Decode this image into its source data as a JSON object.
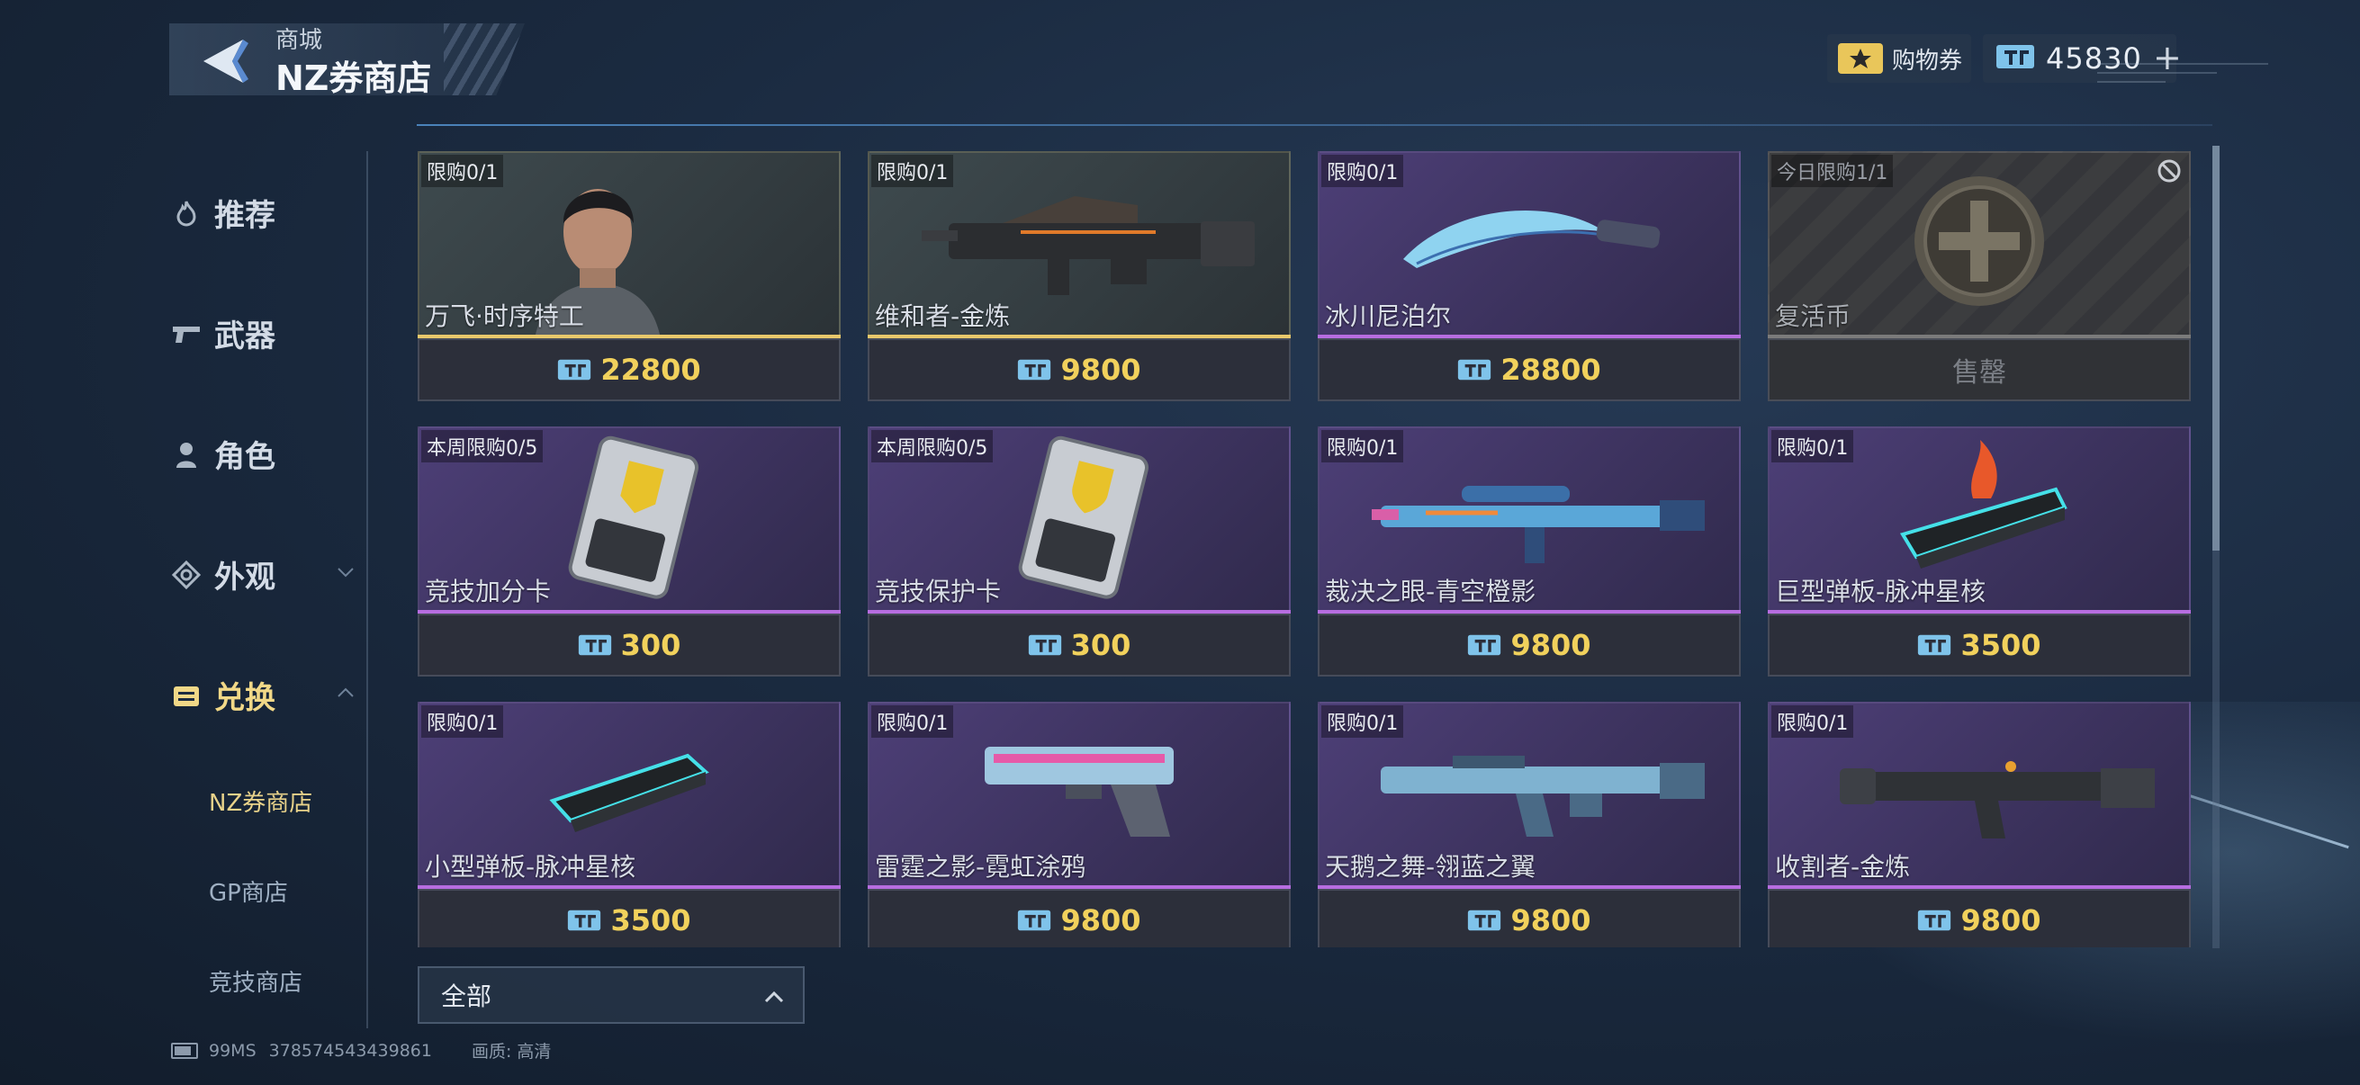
{
  "header": {
    "breadcrumb": "商城",
    "title": "NZ券商店"
  },
  "currencies": {
    "voucher_label": "购物券",
    "nz_amount": "45830",
    "plus": "+"
  },
  "sidebar": {
    "items": [
      {
        "label": "推荐",
        "icon": "fire-icon"
      },
      {
        "label": "武器",
        "icon": "gun-icon"
      },
      {
        "label": "角色",
        "icon": "person-icon"
      },
      {
        "label": "外观",
        "icon": "skin-icon"
      },
      {
        "label": "兑换",
        "icon": "exchange-icon"
      }
    ],
    "sub_items": [
      {
        "label": "NZ券商店"
      },
      {
        "label": "GP商店"
      },
      {
        "label": "竞技商店"
      }
    ]
  },
  "cards": [
    {
      "limit": "限购0/1",
      "name": "万飞·时序特工",
      "price": "22800",
      "rarity": "gold"
    },
    {
      "limit": "限购0/1",
      "name": "维和者-金炼",
      "price": "9800",
      "rarity": "gold"
    },
    {
      "limit": "限购0/1",
      "name": "冰川尼泊尔",
      "price": "28800",
      "rarity": "purple"
    },
    {
      "limit": "今日限购1/1",
      "name": "复活币",
      "price": "售罄",
      "rarity": "sold"
    },
    {
      "limit": "本周限购0/5",
      "name": "竞技加分卡",
      "price": "300",
      "rarity": "purple"
    },
    {
      "limit": "本周限购0/5",
      "name": "竞技保护卡",
      "price": "300",
      "rarity": "purple"
    },
    {
      "limit": "限购0/1",
      "name": "裁决之眼-青空橙影",
      "price": "9800",
      "rarity": "purple"
    },
    {
      "limit": "限购0/1",
      "name": "巨型弹板-脉冲星核",
      "price": "3500",
      "rarity": "purple"
    },
    {
      "limit": "限购0/1",
      "name": "小型弹板-脉冲星核",
      "price": "3500",
      "rarity": "purple"
    },
    {
      "limit": "限购0/1",
      "name": "雷霆之影-霓虹涂鸦",
      "price": "9800",
      "rarity": "purple"
    },
    {
      "limit": "限购0/1",
      "name": "天鹅之舞-翎蓝之翼",
      "price": "9800",
      "rarity": "purple"
    },
    {
      "limit": "限购0/1",
      "name": "收割者-金炼",
      "price": "9800",
      "rarity": "purple"
    }
  ],
  "filter": {
    "label": "全部"
  },
  "status": {
    "ping": "99MS",
    "uid": "378574543439861",
    "quality": "画质: 高清"
  },
  "colors": {
    "accent_gold": "#f1d15c",
    "rarity_purple": "#b76de0",
    "rarity_gold": "#e8c86b"
  }
}
